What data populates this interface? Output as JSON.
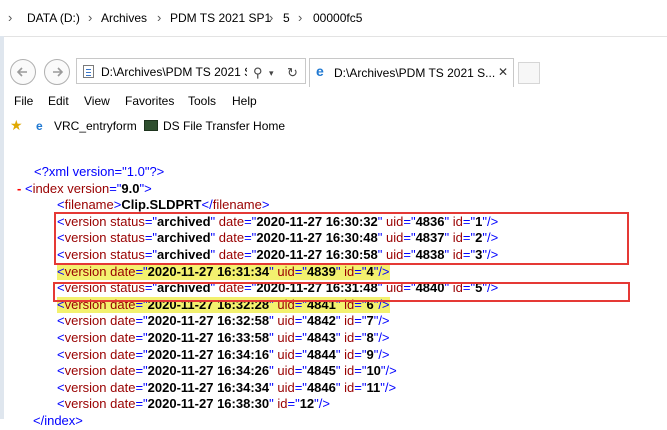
{
  "breadcrumb": [
    "DATA (D:)",
    "Archives",
    "PDM TS 2021 SP1",
    "5",
    "00000fc5"
  ],
  "browser": {
    "address_text": "D:\\Archives\\PDM TS 2021 SP",
    "tab_title": "D:\\Archives\\PDM TS 2021 S...",
    "menu": [
      "File",
      "Edit",
      "View",
      "Favorites",
      "Tools",
      "Help"
    ],
    "favorites": [
      "VRC_entryform",
      "DS File Transfer Home"
    ]
  },
  "xml": {
    "declaration": "<?xml version=\"1.0\"?>",
    "collapse_symbol": "-",
    "index_open_tag": "index",
    "index_attr": "version",
    "index_version": "9.0",
    "filename_tag": "filename",
    "filename_value": "Clip.SLDPRT",
    "versions": [
      {
        "status": "archived",
        "date": "2020-11-27 16:30:32",
        "uid": "4836",
        "id": "1"
      },
      {
        "status": "archived",
        "date": "2020-11-27 16:30:48",
        "uid": "4837",
        "id": "2"
      },
      {
        "status": "archived",
        "date": "2020-11-27 16:30:58",
        "uid": "4838",
        "id": "3"
      },
      {
        "date": "2020-11-27 16:31:34",
        "uid": "4839",
        "id": "4"
      },
      {
        "status": "archived",
        "date": "2020-11-27 16:31:48",
        "uid": "4840",
        "id": "5"
      },
      {
        "date": "2020-11-27 16:32:28",
        "uid": "4841",
        "id": "6"
      },
      {
        "date": "2020-11-27 16:32:58",
        "uid": "4842",
        "id": "7"
      },
      {
        "date": "2020-11-27 16:33:58",
        "uid": "4843",
        "id": "8"
      },
      {
        "date": "2020-11-27 16:34:16",
        "uid": "4844",
        "id": "9"
      },
      {
        "date": "2020-11-27 16:34:26",
        "uid": "4845",
        "id": "10"
      },
      {
        "date": "2020-11-27 16:34:34",
        "uid": "4846",
        "id": "11"
      },
      {
        "date": "2020-11-27 16:38:30",
        "id": "12"
      }
    ],
    "index_close_tag": "</index>"
  },
  "highlight_color": "#f3f16f",
  "box_color": "#e53935"
}
